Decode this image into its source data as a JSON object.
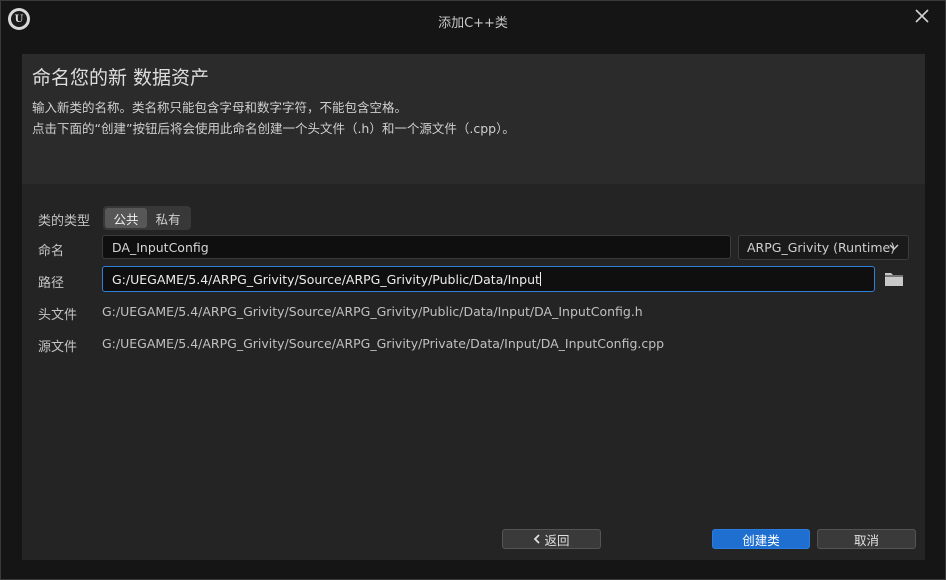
{
  "window": {
    "title": "添加C++类",
    "logo_text": "U"
  },
  "header": {
    "heading": "命名您的新 数据资产",
    "line1": "输入新类的名称。类名称只能包含字母和数字字符，不能包含空格。",
    "line2": "点击下面的“创建”按钮后将会使用此命名创建一个头文件（.h）和一个源文件（.cpp）。"
  },
  "form": {
    "class_type_label": "类的类型",
    "class_type_options": [
      "公共",
      "私有"
    ],
    "class_type_selected": "公共",
    "name_label": "命名",
    "name_value": "DA_InputConfig",
    "module_value": "ARPG_Grivity (Runtime)",
    "path_label": "路径",
    "path_value": "G:/UEGAME/5.4/ARPG_Grivity/Source/ARPG_Grivity/Public/Data/Input",
    "header_label": "头文件",
    "header_value": "G:/UEGAME/5.4/ARPG_Grivity/Source/ARPG_Grivity/Public/Data/Input/DA_InputConfig.h",
    "source_label": "源文件",
    "source_value": "G:/UEGAME/5.4/ARPG_Grivity/Source/ARPG_Grivity/Private/Data/Input/DA_InputConfig.cpp"
  },
  "buttons": {
    "back": "返回",
    "create": "创建类",
    "cancel": "取消"
  },
  "icons": {
    "logo": "unreal-logo-icon",
    "close": "close-icon",
    "dropdown": "chevron-down-icon",
    "folder": "folder-icon",
    "back": "chevron-left-icon"
  },
  "colors": {
    "accent": "#1f6fd1",
    "focus_border": "#2f7fd6",
    "background": "#151515",
    "panel": "#242424"
  }
}
